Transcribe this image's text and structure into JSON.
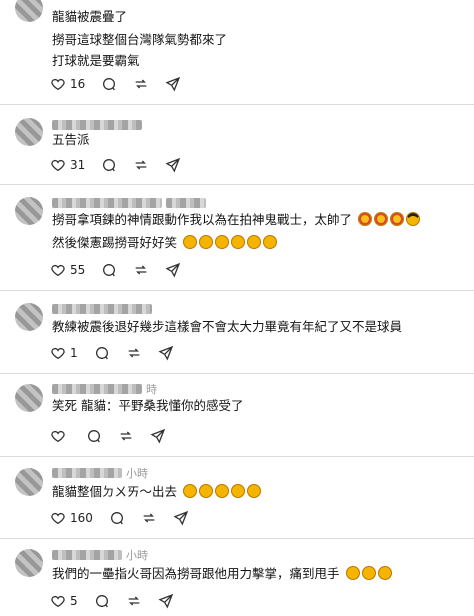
{
  "posts": [
    {
      "header_time": "",
      "lines": [
        "龍貓被震疊了",
        "撈哥這球整個台灣隊氣勢都來了",
        "打球就是要霸氣"
      ],
      "emoji_after": [],
      "likes": "16"
    },
    {
      "header_time": "",
      "lines": [
        "五告派"
      ],
      "emoji_after": [],
      "likes": "31"
    },
    {
      "header_time": "",
      "lines": [
        "撈哥拿項鍊的神情跟動作我以為在拍神鬼戰士，太帥了",
        "然後傑憲踢撈哥好好笑"
      ],
      "emoji_after": [
        [
          "star-struck",
          "star-struck",
          "star-struck",
          "smiling-sunglasses"
        ],
        [
          "rofl",
          "rofl",
          "rofl",
          "rofl",
          "rofl",
          "rofl"
        ]
      ],
      "likes": "55"
    },
    {
      "header_time": "",
      "lines": [
        "教練被震後退好幾步這樣會不會太大力畢竟有年紀了又不是球員"
      ],
      "emoji_after": [],
      "likes": "1"
    },
    {
      "header_time": "時",
      "lines": [
        "笑死 龍貓：平野桑我懂你的感受了"
      ],
      "emoji_after": [],
      "likes": ""
    },
    {
      "header_time": "小時",
      "lines": [
        "龍貓整個ㄉㄨㄞ～出去"
      ],
      "emoji_after": [
        [
          "rofl",
          "rofl",
          "rofl",
          "rofl",
          "rofl"
        ]
      ],
      "likes": "160"
    },
    {
      "header_time": "小時",
      "lines": [
        "我們的一壘指火哥因為撈哥跟他用力擊掌，痛到甩手"
      ],
      "emoji_after": [
        [
          "rofl",
          "rofl",
          "rofl"
        ]
      ],
      "likes": "5"
    }
  ],
  "icons": {
    "like": "heart-icon",
    "comment": "comment-icon",
    "repost": "repost-icon",
    "share": "share-icon"
  }
}
